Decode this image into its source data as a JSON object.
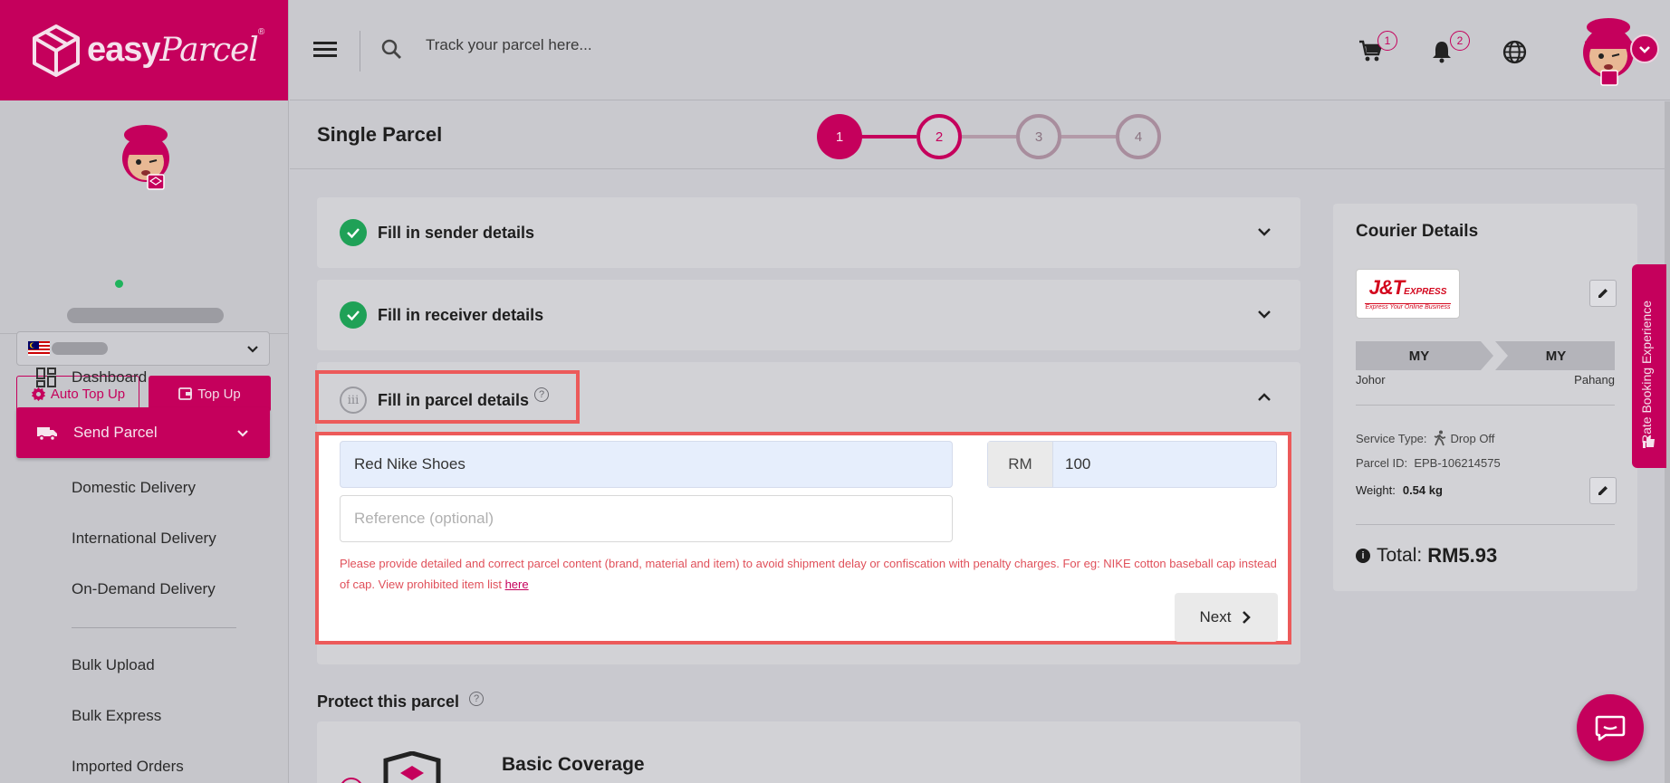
{
  "brand": {
    "logo_easy": "easy",
    "logo_parcel": "Parcel",
    "logo_reg": "®",
    "color_primary": "#c5005c"
  },
  "topbar": {
    "search_placeholder": "Track your parcel here...",
    "cart_count": "1",
    "notification_count": "2"
  },
  "sidebar": {
    "auto_topup_label": "Auto Top Up",
    "topup_label": "Top Up",
    "nav": [
      {
        "label": "Dashboard",
        "icon": "dashboard-icon"
      },
      {
        "label": "Send Parcel",
        "icon": "truck-icon",
        "active": true
      }
    ],
    "sub_items": [
      "Domestic Delivery",
      "International Delivery",
      "On-Demand Delivery",
      "Bulk Upload",
      "Bulk Express",
      "Imported Orders"
    ]
  },
  "page": {
    "title": "Single Parcel",
    "steps": [
      "1",
      "2",
      "3",
      "4"
    ],
    "current_step": 2
  },
  "sections": {
    "sender": "Fill in sender details",
    "receiver": "Fill in receiver details",
    "parcel": "Fill in parcel details",
    "parcel_step_roman": "iii",
    "help_mark": "?"
  },
  "parcel_form": {
    "content_value": "Red Nike Shoes",
    "currency_prefix": "RM",
    "value_amount": "100",
    "reference_placeholder": "Reference (optional)",
    "warning_text": "Please provide detailed and correct parcel content (brand, material and item) to avoid shipment delay or confiscation with penalty charges. For eg: NIKE cotton baseball cap instead of cap. View prohibited item list ",
    "warning_link": "here",
    "next_label": "Next"
  },
  "protection": {
    "title": "Protect this parcel",
    "basic_coverage": "Basic Coverage"
  },
  "courier": {
    "title": "Courier Details",
    "logo_main": "J&T",
    "logo_express": "EXPRESS",
    "logo_tagline": "Express Your Online Business",
    "from_country": "MY",
    "to_country": "MY",
    "from_state": "Johor",
    "to_state": "Pahang",
    "service_type_label": "Service Type:",
    "service_type_value": "Drop Off",
    "parcel_id_label": "Parcel ID:",
    "parcel_id_value": "EPB-106214575",
    "weight_label": "Weight:",
    "weight_value": "0.54 kg",
    "total_label": "Total:",
    "total_value": "RM5.93"
  },
  "side_tab": {
    "label": "Rate Booking Experience"
  }
}
